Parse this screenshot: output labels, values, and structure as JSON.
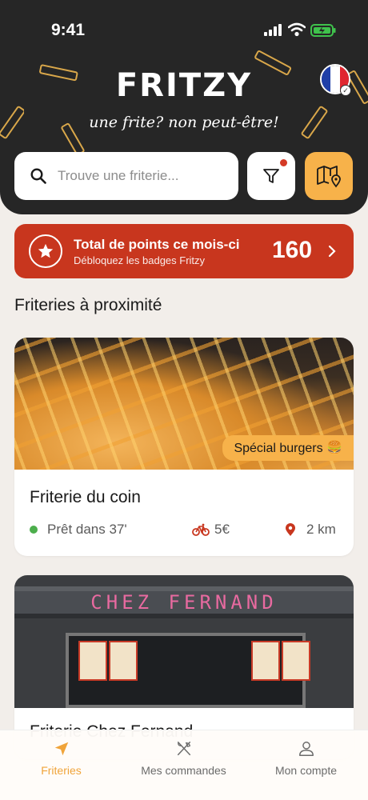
{
  "status_bar": {
    "time": "9:41"
  },
  "header": {
    "logo": "FRITZY",
    "tagline": "une frite? non peut-être!",
    "language": "FR"
  },
  "search": {
    "placeholder": "Trouve une friterie..."
  },
  "icons": {
    "search": "search-icon",
    "filter": "filter-icon",
    "map": "map-pin-icon",
    "star": "star-icon",
    "chevron": "chevron-right-icon",
    "bike": "bike-icon",
    "location": "location-pin-icon"
  },
  "points_banner": {
    "title": "Total de points ce mois-ci",
    "subtitle": "Débloquez les badges Fritzy",
    "value": "160"
  },
  "section_title": "Friteries à proximité",
  "friteries": [
    {
      "name": "Friterie du coin",
      "badge": "Spécial burgers 🍔",
      "ready": "Prêt dans 37'",
      "delivery_fee": "5€",
      "distance": "2 km"
    },
    {
      "name": "Friterie Chez Fernand",
      "sign": "CHEZ FERNAND"
    }
  ],
  "tabs": [
    {
      "label": "Friteries",
      "active": true
    },
    {
      "label": "Mes commandes",
      "active": false
    },
    {
      "label": "Mon compte",
      "active": false
    }
  ],
  "colors": {
    "header_bg": "#262626",
    "accent": "#f7b24a",
    "points_bg": "#c8361e",
    "ready_green": "#4cae4c",
    "page_bg": "#f2eeea"
  }
}
